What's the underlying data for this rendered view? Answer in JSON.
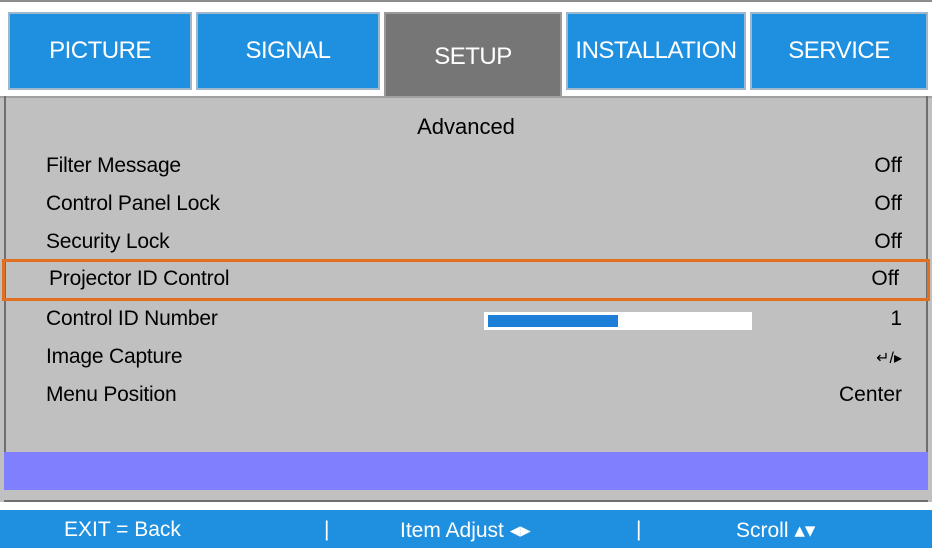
{
  "tabs": [
    {
      "label": "PICTURE"
    },
    {
      "label": "SIGNAL"
    },
    {
      "label": "SETUP"
    },
    {
      "label": "INSTALLATION"
    },
    {
      "label": "SERVICE"
    }
  ],
  "active_tab": "SETUP",
  "panel": {
    "title": "Advanced",
    "rows": [
      {
        "label": "Filter Message",
        "value": "Off"
      },
      {
        "label": "Control Panel Lock",
        "value": "Off"
      },
      {
        "label": "Security Lock",
        "value": "Off"
      },
      {
        "label": "Projector ID Control",
        "value": "Off",
        "selected": true
      },
      {
        "label": "Control ID Number",
        "value": "1",
        "slider_fraction": 0.5
      },
      {
        "label": "Image Capture",
        "value": "↵/▸"
      },
      {
        "label": "Menu Position",
        "value": "Center"
      }
    ]
  },
  "footer": {
    "exit": "EXIT = Back",
    "sep1": "|",
    "adjust": "Item Adjust ◂▸",
    "sep2": "|",
    "scroll": "Scroll ▴▾"
  },
  "colors": {
    "tab_blue": "#1f8fe0",
    "tab_active": "#767676",
    "panel_gray": "#c0c0c0",
    "highlight_orange": "#e07020",
    "hint_bar": "#8080ff"
  }
}
